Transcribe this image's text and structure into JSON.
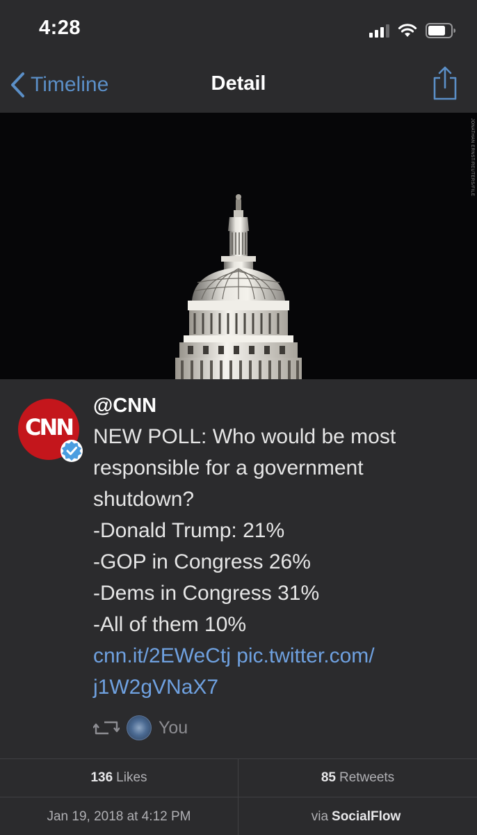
{
  "status_bar": {
    "time": "4:28",
    "icons": [
      "cellular-signal-icon",
      "wifi-icon",
      "battery-icon"
    ]
  },
  "nav": {
    "back_label": "Timeline",
    "title": "Detail",
    "share_icon": "share-icon"
  },
  "hero_image": {
    "credit": "JONATHAN ERNST/REUTERS/FILE"
  },
  "tweet": {
    "handle": "@CNN",
    "avatar_text": "CNN",
    "verified": true,
    "body_lines": [
      "NEW POLL: Who would be most",
      "responsible for a government",
      "shutdown?",
      "-Donald Trump: 21%",
      "-GOP in Congress 26%",
      "-Dems in Congress 31%",
      "-All of them 10%"
    ],
    "links": {
      "short_link": "cnn.it/2EWeCtj",
      "pic_link_part1": "pic.twitter.com/",
      "pic_link_part2": "j1W2gVNaX7"
    },
    "retweeted_by": "You"
  },
  "stats": {
    "likes_count": "136",
    "likes_label": "Likes",
    "retweets_count": "85",
    "retweets_label": "Retweets",
    "date": "Jan 19, 2018 at 4:12 PM",
    "via_prefix": "via",
    "via_source": "SocialFlow"
  },
  "colors": {
    "background": "#2b2b2d",
    "accent_link": "#6fa1e0",
    "nav_accent": "#5b8fc7",
    "cnn_red": "#c4161c",
    "verified_blue": "#4a9de0"
  }
}
